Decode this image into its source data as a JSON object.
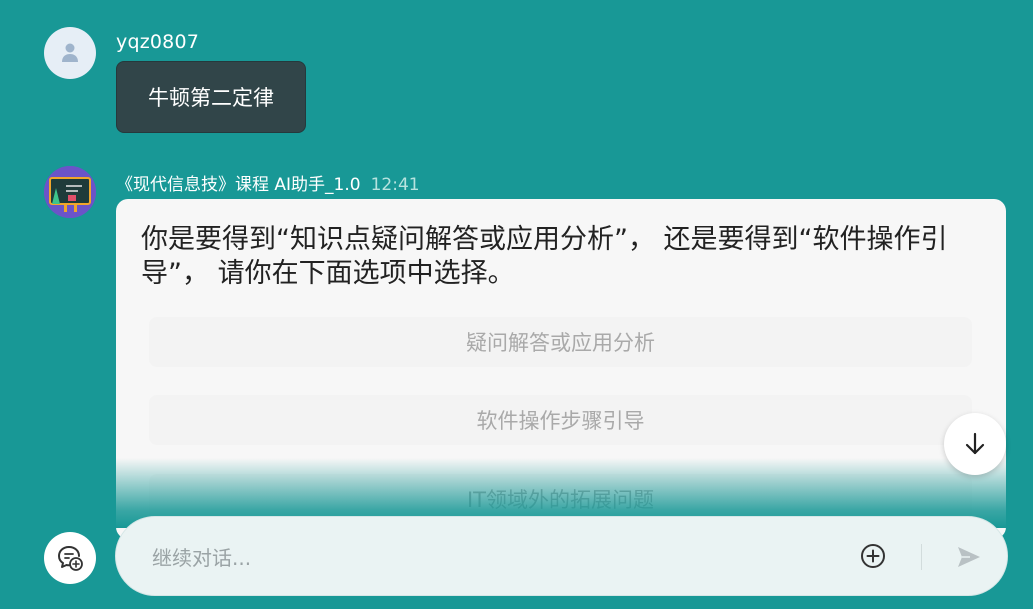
{
  "user_message": {
    "username": "yqz0807",
    "text": "牛顿第二定律",
    "avatar_icon": "user-icon"
  },
  "bot_message": {
    "name": "《现代信息技》课程 AI助手_1.0",
    "time": "12:41",
    "avatar_icon": "blackboard-icon",
    "text": "你是要得到“知识点疑问解答或应用分析”， 还是要得到“软件操作引导”， 请你在下面选项中选择。",
    "choices": [
      "疑问解答或应用分析",
      "软件操作步骤引导",
      "IT领域外的拓展问题"
    ]
  },
  "scroll_button": {
    "icon": "arrow-down-icon"
  },
  "new_chat_button": {
    "icon": "chat-plus-icon"
  },
  "composer": {
    "placeholder": "继续对话...",
    "value": "",
    "attach_icon": "plus-circle-icon",
    "send_icon": "send-icon"
  },
  "colors": {
    "background": "#189896",
    "user_bubble": "#314549",
    "card": "#f7f7f7",
    "choice_text": "#a9a9a9"
  }
}
